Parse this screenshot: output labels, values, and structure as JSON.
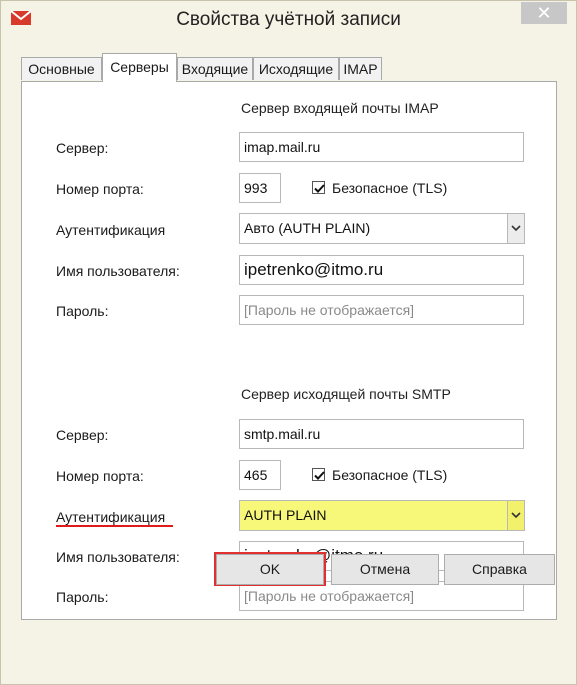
{
  "window": {
    "title": "Свойства учётной записи",
    "close_label": "✕"
  },
  "tabs": [
    "Основные",
    "Серверы",
    "Входящие",
    "Исходящие",
    "IMAP"
  ],
  "incoming": {
    "title": "Сервер входящей почты IMAP",
    "server_label": "Сервер:",
    "server_value": "imap.mail.ru",
    "port_label": "Номер порта:",
    "port_value": "993",
    "secure_label": "Безопасное (TLS)",
    "auth_label": "Аутентификация",
    "auth_value": "Авто  (AUTH PLAIN)",
    "user_label": "Имя пользователя:",
    "user_value": "ipetrenko@itmo.ru",
    "password_label": "Пароль:",
    "password_placeholder": "[Пароль не отображается]"
  },
  "outgoing": {
    "title": "Сервер исходящей почты SMTP",
    "server_label": "Сервер:",
    "server_value": "smtp.mail.ru",
    "port_label": "Номер порта:",
    "port_value": "465",
    "secure_label": "Безопасное (TLS)",
    "auth_label": "Аутентификация",
    "auth_value": "AUTH PLAIN",
    "user_label": "Имя пользователя:",
    "user_value": "ipetrenko@itmo.ru",
    "password_label": "Пароль:",
    "password_placeholder": "[Пароль не отображается]"
  },
  "buttons": {
    "ok": "OK",
    "cancel": "Отмена",
    "help": "Справка"
  },
  "colors": {
    "highlight": "#f7f77a",
    "annotation_red": "#e01b1b"
  }
}
